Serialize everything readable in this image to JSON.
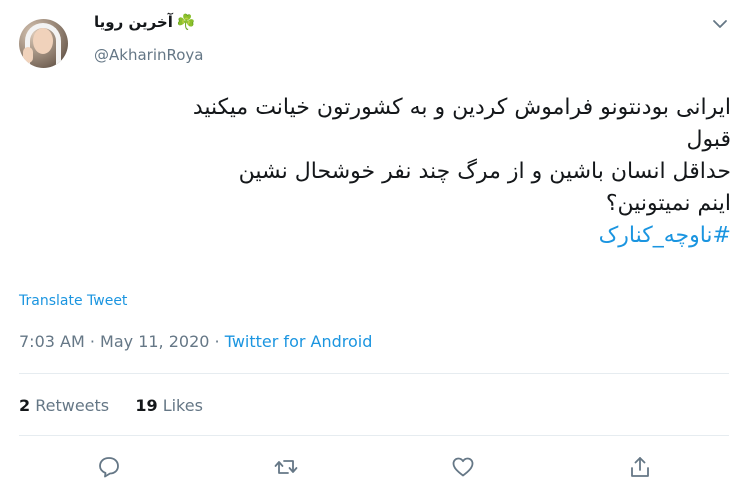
{
  "user": {
    "display_name": "آخرین رویا",
    "emoji": "☘️",
    "handle": "@AkharinRoya"
  },
  "tweet": {
    "lines": [
      "ایرانی بودنتونو فراموش کردین و به کشورتون خیانت میکنید",
      "قبول",
      "حداقل انسان باشین و از مرگ چند نفر خوشحال نشین",
      "اینم نمیتونین؟"
    ],
    "hashtag": "#ناوچه_کنارک"
  },
  "translate_label": "Translate Tweet",
  "meta": {
    "time": "7:03 AM",
    "separator": " · ",
    "date": "May 11, 2020",
    "source": "Twitter for Android"
  },
  "stats": {
    "retweets_count": "2",
    "retweets_label": "Retweets",
    "likes_count": "19",
    "likes_label": "Likes"
  },
  "icons": {
    "more": "chevron-down-icon",
    "reply": "reply-icon",
    "retweet": "retweet-icon",
    "like": "like-icon",
    "share": "share-icon"
  },
  "colors": {
    "link": "#1b95e0",
    "secondary_text": "#657786",
    "primary_text": "#14171a",
    "divider": "#e6ecf0"
  }
}
